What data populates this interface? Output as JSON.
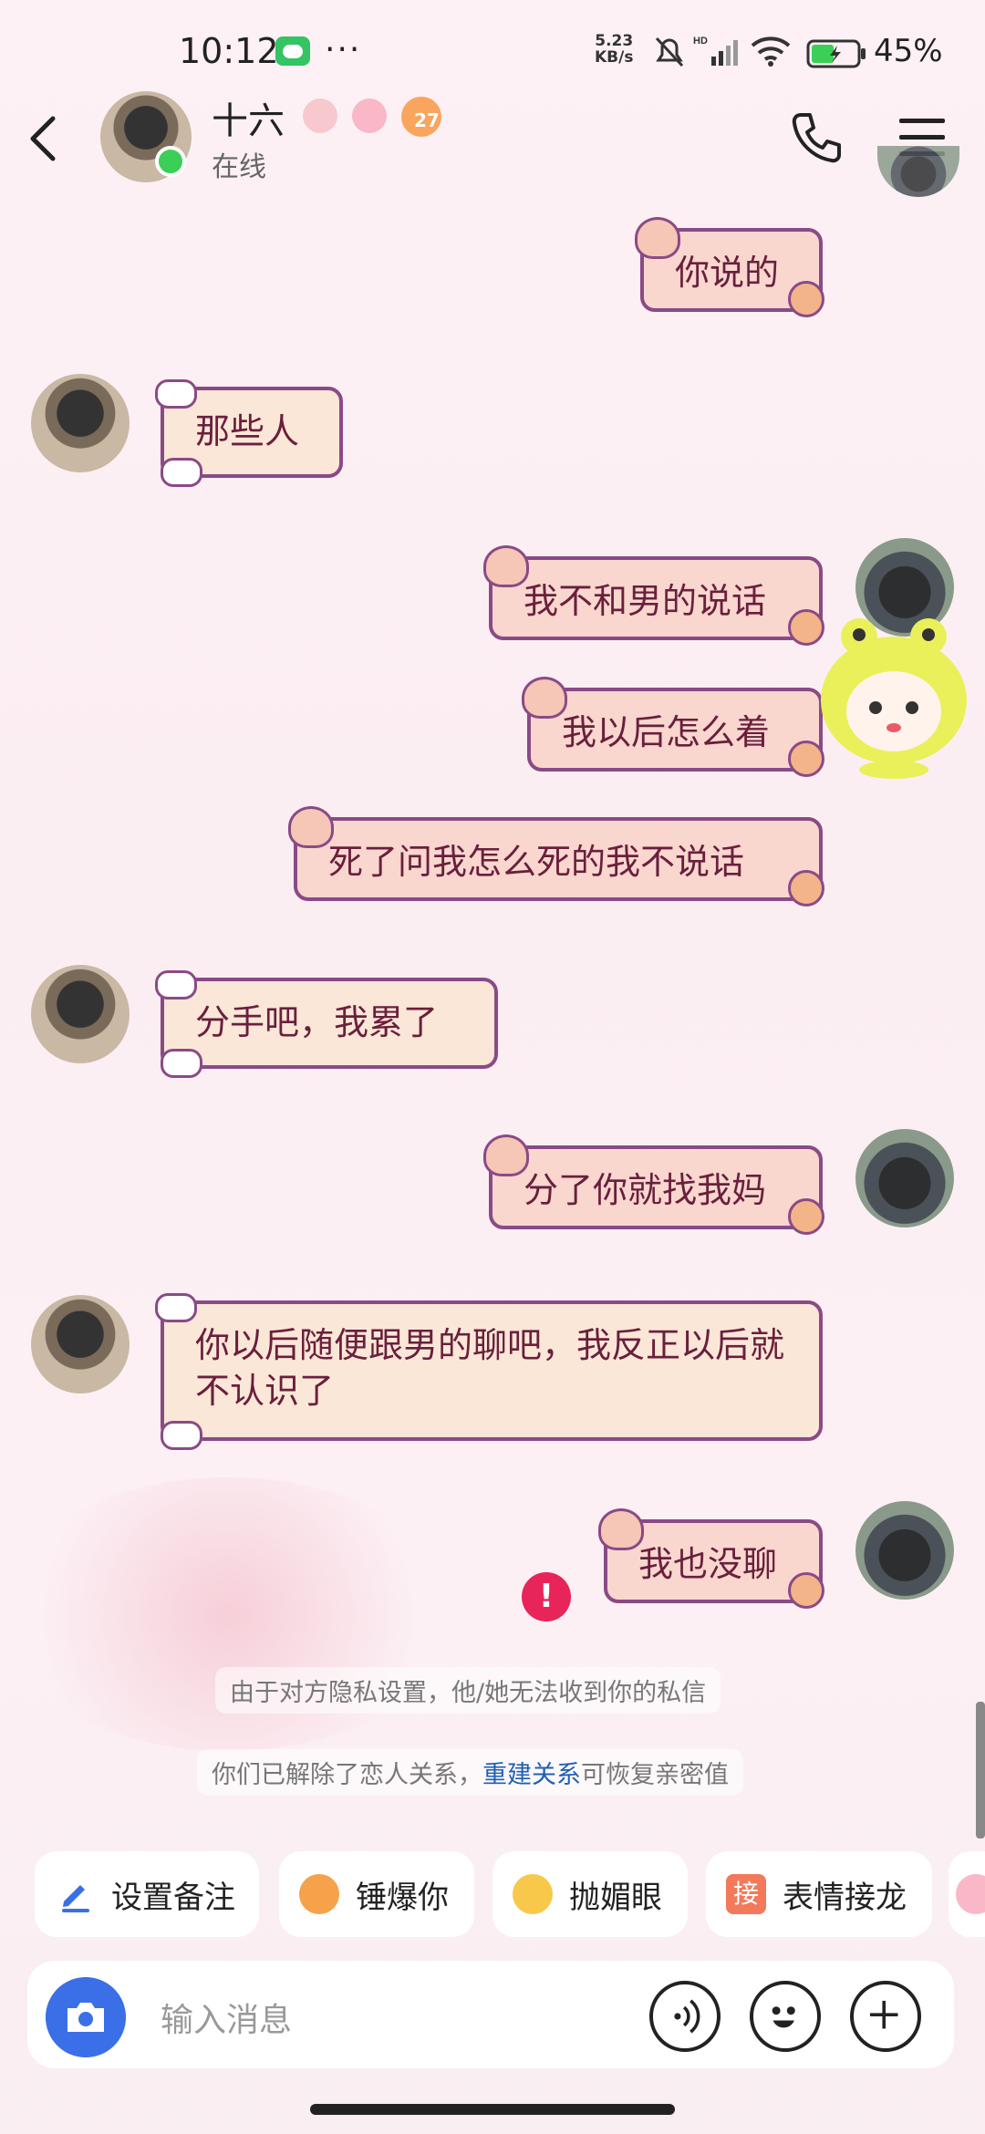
{
  "status_bar": {
    "time": "10:12",
    "dots": "···",
    "net_speed_value": "5.23",
    "net_speed_unit": "KB/s",
    "battery": "45%"
  },
  "header": {
    "contact_name": "十六",
    "status": "在线",
    "level_badge": "27"
  },
  "messages": [
    {
      "side": "out",
      "text": "你说的"
    },
    {
      "side": "in",
      "text": "那些人"
    },
    {
      "side": "out",
      "text": "我不和男的说话"
    },
    {
      "side": "out",
      "text": "我以后怎么着"
    },
    {
      "side": "out",
      "text": "死了问我怎么死的我不说话"
    },
    {
      "side": "in",
      "text": "分手吧，我累了"
    },
    {
      "side": "out",
      "text": "分了你就找我妈"
    },
    {
      "side": "in",
      "text": "你以后随便跟男的聊吧，我反正以后就不认识了"
    },
    {
      "side": "out",
      "text": "我也没聊"
    }
  ],
  "error_mark": "!",
  "system_notes": {
    "privacy": "由于对方隐私设置，他/她无法收到你的私信",
    "relation_prefix": "你们已解除了恋人关系，",
    "relation_link": "重建关系",
    "relation_suffix": "可恢复亲密值"
  },
  "quick_actions": [
    {
      "label": "设置备注",
      "icon": "pencil-icon"
    },
    {
      "label": "锤爆你",
      "icon": "hammer-sticker-icon"
    },
    {
      "label": "抛媚眼",
      "icon": "wink-sticker-icon"
    },
    {
      "label": "表情接龙",
      "icon": "relay-icon",
      "icon_text": "接"
    }
  ],
  "input": {
    "placeholder": "输入消息"
  },
  "colors": {
    "accent_blue": "#3a6fe8",
    "online_green": "#3ccf58",
    "error_red": "#e8245a",
    "bubble_text": "#6a1f3c"
  }
}
